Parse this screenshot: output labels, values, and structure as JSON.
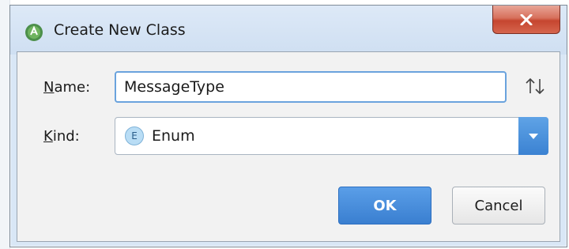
{
  "window": {
    "title": "Create New Class",
    "close_symbol": "x"
  },
  "form": {
    "name_label_mnemonic": "N",
    "name_label_rest": "ame:",
    "name_value": "MessageType",
    "kind_label_mnemonic": "K",
    "kind_label_rest": "ind:",
    "kind_badge": "E",
    "kind_value": "Enum"
  },
  "buttons": {
    "ok_label": "OK",
    "cancel_label": "Cancel"
  },
  "icons": {
    "app": "android-studio-icon",
    "sort": "sort-up-down-icon",
    "dropdown": "chevron-down-icon",
    "close": "close-icon"
  },
  "colors": {
    "accent": "#3a7fd0",
    "close_red": "#c6462f",
    "window_frame": "#d9e7f6"
  }
}
